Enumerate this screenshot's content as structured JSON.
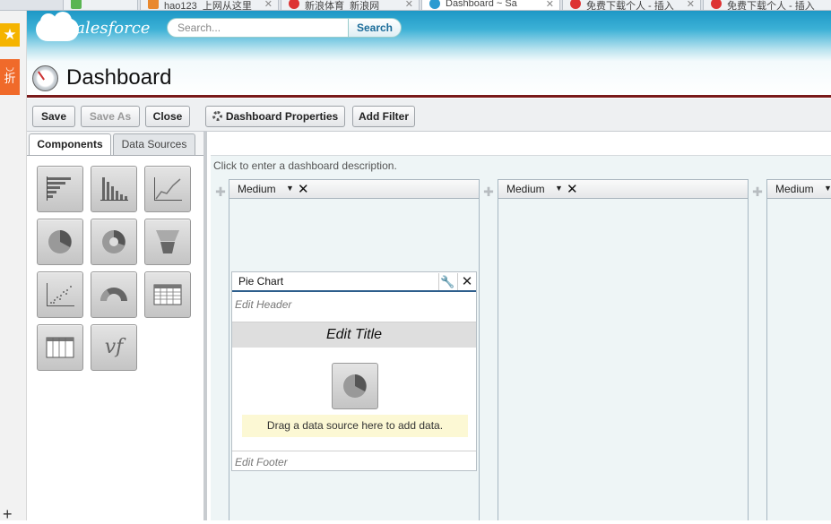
{
  "browser": {
    "tabs": [
      {
        "label": "",
        "fav_color": "#5ab552"
      },
      {
        "label": "hao123_上网从这里",
        "fav_color": "#e9882d"
      },
      {
        "label": "新浪体育_新浪网",
        "fav_color": "#d33"
      },
      {
        "label": "Dashboard ~ Sa",
        "fav_color": "#2a9bd1"
      },
      {
        "label": "免费下载个人 - 插入",
        "fav_color": "#d33"
      },
      {
        "label": "免费下载个人 - 插入",
        "fav_color": "#d33"
      }
    ],
    "sidebar": {
      "star_icon": "star-icon",
      "zhe_label": "折"
    }
  },
  "header": {
    "logo_text": "salesforce",
    "search_placeholder": "Search...",
    "search_button": "Search",
    "page_title": "Dashboard"
  },
  "toolbar": {
    "save": "Save",
    "save_as": "Save As",
    "close": "Close",
    "dashboard_properties": "Dashboard Properties",
    "add_filter": "Add Filter"
  },
  "palette": {
    "tabs": [
      "Components",
      "Data Sources"
    ],
    "components": [
      "horizontal-bar-chart",
      "vertical-bar-chart",
      "line-chart",
      "pie-chart",
      "donut-chart",
      "funnel-chart",
      "scatter-chart",
      "gauge",
      "table",
      "metric-table",
      "visualforce-page"
    ],
    "vf_label": "vf"
  },
  "canvas": {
    "description_hint": "Click to enter a dashboard description.",
    "columns": [
      {
        "size": "Medium"
      },
      {
        "size": "Medium"
      },
      {
        "size": "Medium"
      }
    ],
    "widget": {
      "title": "Pie Chart",
      "edit_header": "Edit Header",
      "edit_title": "Edit Title",
      "drag_hint": "Drag a data source here to add data.",
      "edit_footer": "Edit Footer"
    }
  }
}
